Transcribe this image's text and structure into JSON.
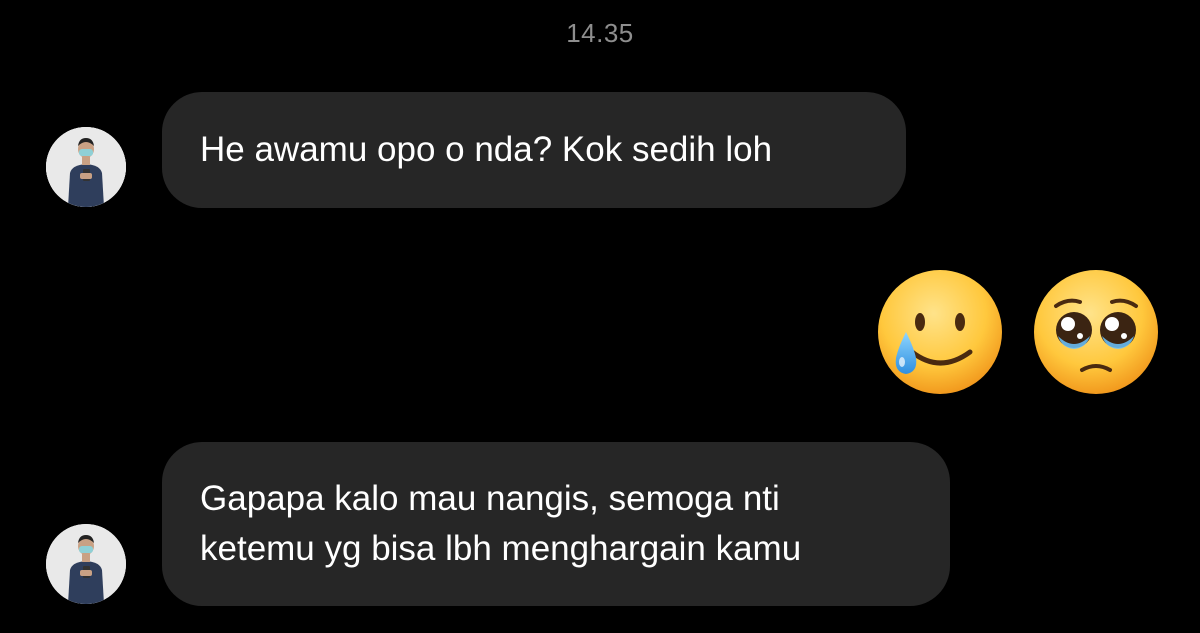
{
  "conversation": {
    "timestamp": "14.35",
    "messages": [
      {
        "sender": "contact",
        "text": "He awamu opo o nda? Kok sedih loh"
      },
      {
        "sender": "self",
        "emojis": [
          "smiling-face-with-tear-emoji",
          "pleading-face-emoji"
        ]
      },
      {
        "sender": "contact",
        "lines": [
          "Gapapa kalo mau nangis, semoga nti",
          "ketemu yg bisa lbh menghargain kamu"
        ]
      }
    ]
  },
  "colors": {
    "background": "#000000",
    "incoming_bubble": "#262626",
    "timestamp_text": "#8e8e8e"
  }
}
